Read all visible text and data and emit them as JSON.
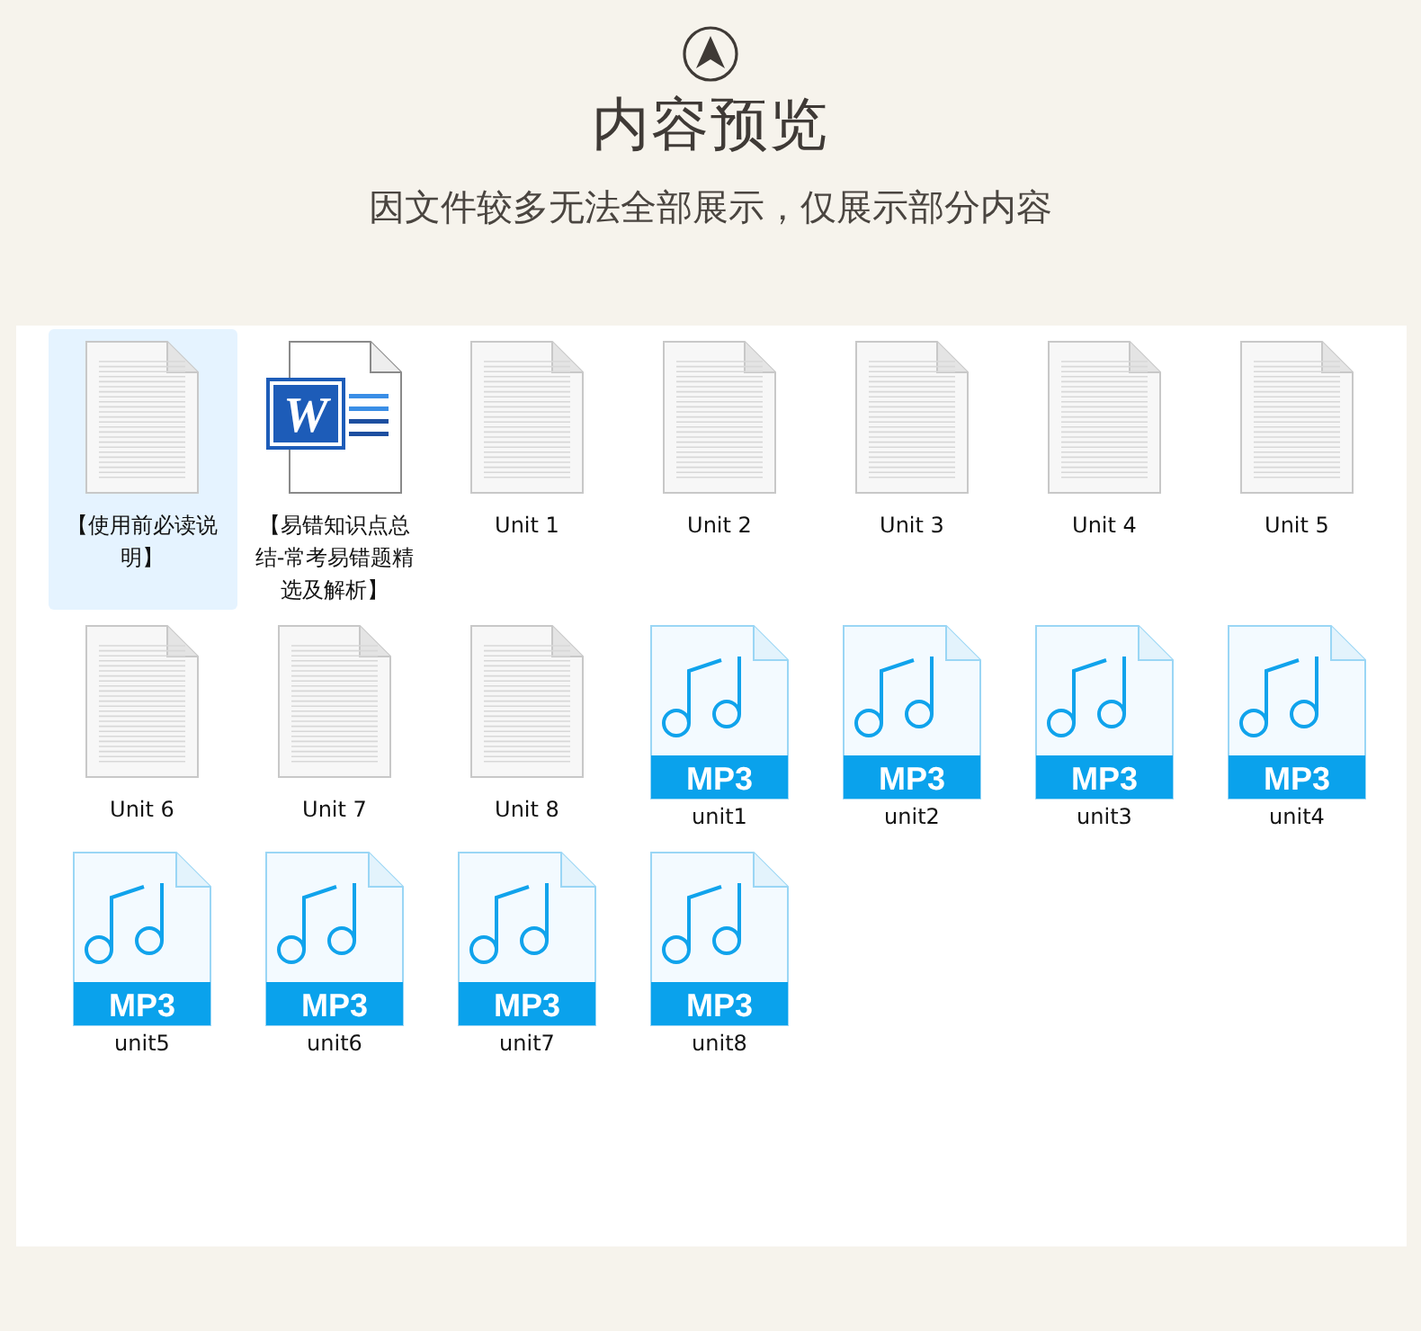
{
  "header": {
    "title": "内容预览",
    "subtitle": "因文件较多无法全部展示，仅展示部分内容"
  },
  "files": [
    {
      "kind": "doc",
      "name": "【使用前必读说明】",
      "selected": true
    },
    {
      "kind": "word",
      "name": "【易错知识点总结-常考易错题精选及解析】",
      "badge": "W",
      "selected": false
    },
    {
      "kind": "doc",
      "name": "Unit 1",
      "selected": false
    },
    {
      "kind": "doc",
      "name": "Unit 2",
      "selected": false
    },
    {
      "kind": "doc",
      "name": "Unit 3",
      "selected": false
    },
    {
      "kind": "doc",
      "name": "Unit 4",
      "selected": false
    },
    {
      "kind": "doc",
      "name": "Unit 5",
      "selected": false
    },
    {
      "kind": "doc",
      "name": "Unit 6",
      "selected": false
    },
    {
      "kind": "doc",
      "name": "Unit 7",
      "selected": false
    },
    {
      "kind": "doc",
      "name": "Unit 8",
      "selected": false
    },
    {
      "kind": "mp3",
      "name": "unit1",
      "badge": "MP3",
      "selected": false
    },
    {
      "kind": "mp3",
      "name": "unit2",
      "badge": "MP3",
      "selected": false
    },
    {
      "kind": "mp3",
      "name": "unit3",
      "badge": "MP3",
      "selected": false
    },
    {
      "kind": "mp3",
      "name": "unit4",
      "badge": "MP3",
      "selected": false
    },
    {
      "kind": "mp3",
      "name": "unit5",
      "badge": "MP3",
      "selected": false
    },
    {
      "kind": "mp3",
      "name": "unit6",
      "badge": "MP3",
      "selected": false
    },
    {
      "kind": "mp3",
      "name": "unit7",
      "badge": "MP3",
      "selected": false
    },
    {
      "kind": "mp3",
      "name": "unit8",
      "badge": "MP3",
      "selected": false
    }
  ]
}
